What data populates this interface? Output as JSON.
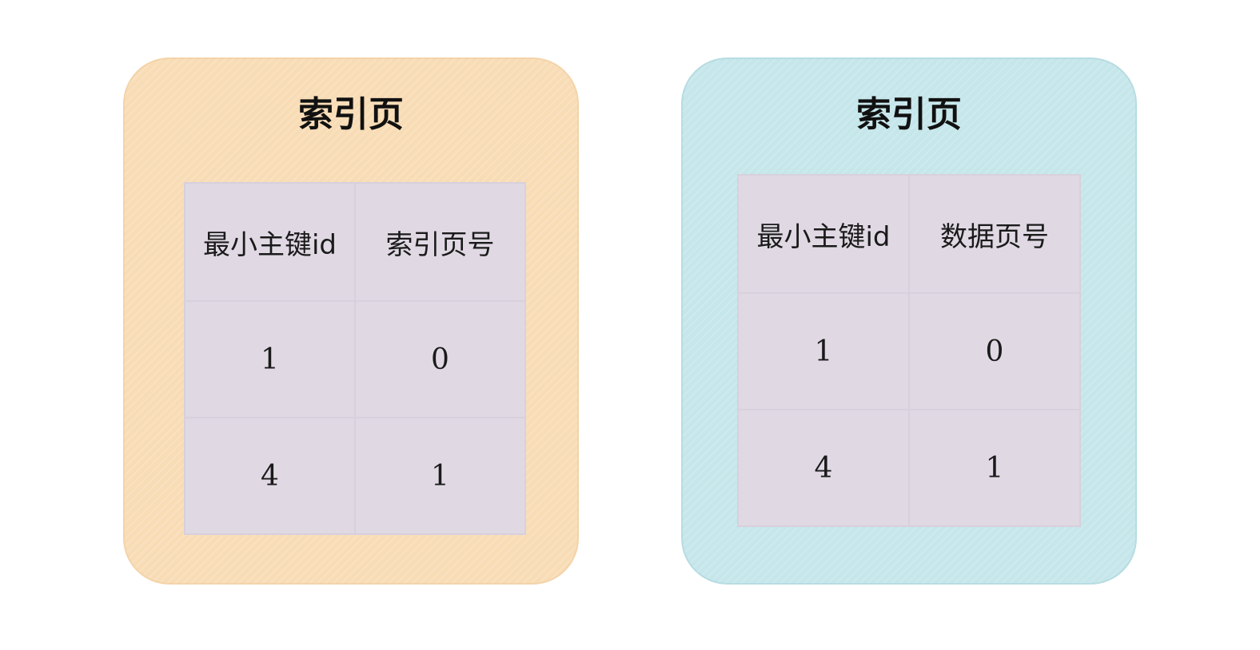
{
  "left_box": {
    "title": "索引页",
    "columns": [
      "最小主键id",
      "索引页号"
    ],
    "rows": [
      [
        "1",
        "0"
      ],
      [
        "4",
        "1"
      ]
    ],
    "color": "#f8dcb5"
  },
  "right_box": {
    "title": "索引页",
    "columns": [
      "最小主键id",
      "数据页号"
    ],
    "rows": [
      [
        "1",
        "0"
      ],
      [
        "4",
        "1"
      ]
    ],
    "color": "#c5e6ea"
  },
  "table_fill_color": "#e0d9e4"
}
